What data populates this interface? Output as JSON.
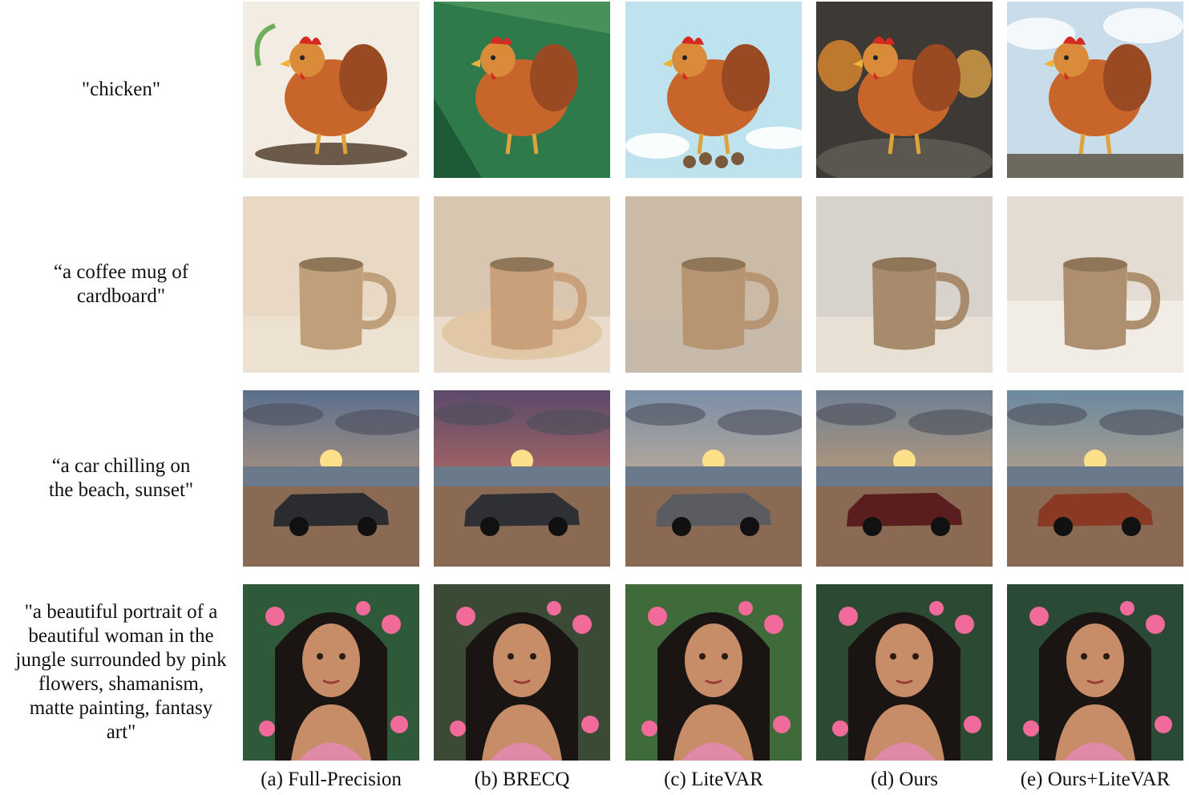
{
  "figure": {
    "rows": [
      {
        "prompt": "\"chicken\"",
        "kind": "chicken"
      },
      {
        "prompt": "“a coffee mug of\ncardboard\"",
        "kind": "mug"
      },
      {
        "prompt": "“a car chilling on\nthe beach, sunset\"",
        "kind": "car"
      },
      {
        "prompt": "\"a beautiful portrait of a\nbeautiful woman in the\njungle surrounded by pink\nflowers, shamanism,\nmatte painting, fantasy\nart\"",
        "kind": "portrait"
      }
    ],
    "columns": [
      {
        "caption": "(a) Full-Precision"
      },
      {
        "caption": "(b) BRECQ"
      },
      {
        "caption": "(c) LiteVAR"
      },
      {
        "caption": "(d) Ours"
      },
      {
        "caption": "(e) Ours+LiteVAR"
      }
    ]
  }
}
